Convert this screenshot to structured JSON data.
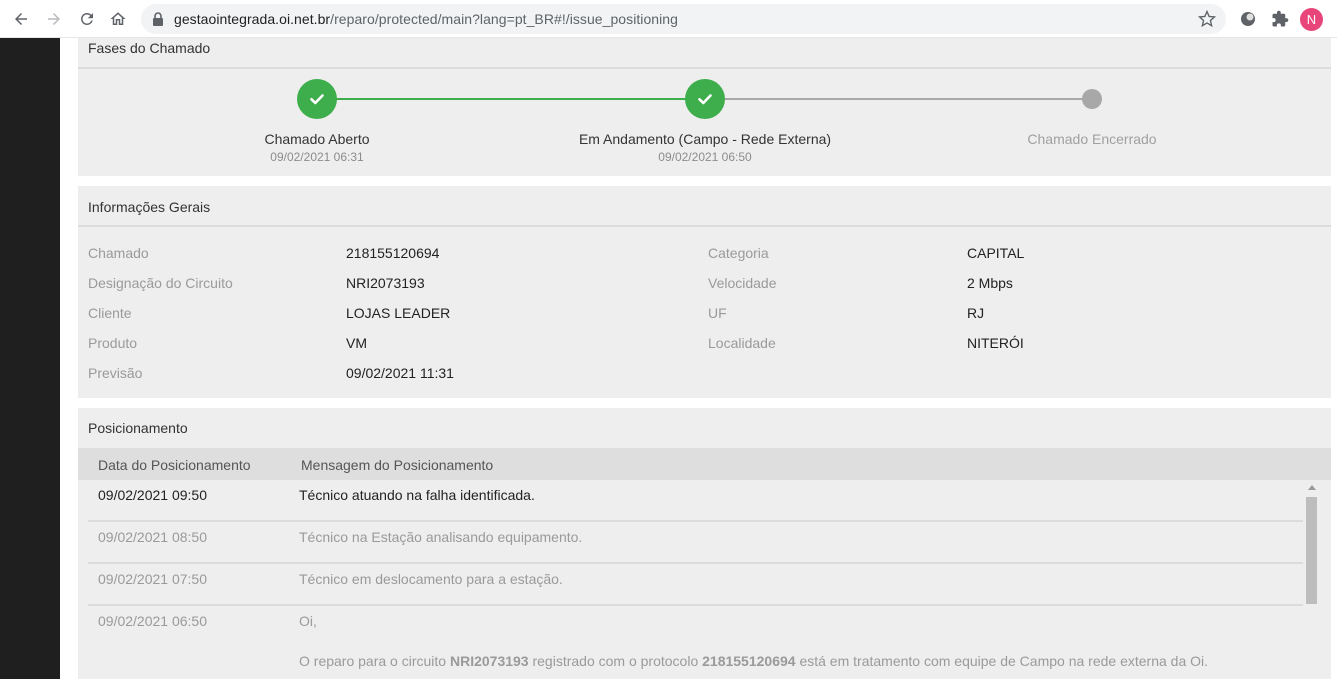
{
  "browser": {
    "url_host": "gestaointegrada.oi.net.br",
    "url_path": "/reparo/protected/main?lang=pt_BR#!/issue_positioning",
    "profile_initial": "N",
    "icons": [
      "back-arrow-icon",
      "forward-arrow-icon",
      "reload-icon",
      "home-icon",
      "lock-icon",
      "star-icon",
      "extension-circle-icon",
      "puzzle-icon"
    ]
  },
  "phases": {
    "title": "Fases do Chamado",
    "steps": [
      {
        "label": "Chamado Aberto",
        "date": "09/02/2021 06:31",
        "status": "done"
      },
      {
        "label": "Em Andamento (Campo - Rede Externa)",
        "date": "09/02/2021 06:50",
        "status": "done"
      },
      {
        "label": "Chamado Encerrado",
        "date": "",
        "status": "pending"
      }
    ]
  },
  "info": {
    "title": "Informações Gerais",
    "left": [
      {
        "label": "Chamado",
        "value": "218155120694"
      },
      {
        "label": "Designação do Circuito",
        "value": "NRI2073193"
      },
      {
        "label": "Cliente",
        "value": "LOJAS LEADER"
      },
      {
        "label": "Produto",
        "value": "VM"
      },
      {
        "label": "Previsão",
        "value": "09/02/2021 11:31"
      }
    ],
    "right": [
      {
        "label": "Categoria",
        "value": "CAPITAL"
      },
      {
        "label": "Velocidade",
        "value": "2 Mbps"
      },
      {
        "label": "UF",
        "value": "RJ"
      },
      {
        "label": "Localidade",
        "value": "NITERÓI"
      }
    ]
  },
  "positioning": {
    "title": "Posicionamento",
    "columns": [
      "Data do Posicionamento",
      "Mensagem do Posicionamento"
    ],
    "rows": [
      {
        "date": "09/02/2021 09:50",
        "message": "Técnico atuando na falha identificada."
      },
      {
        "date": "09/02/2021 08:50",
        "message": "Técnico na Estação analisando equipamento."
      },
      {
        "date": "09/02/2021 07:50",
        "message": "Técnico em deslocamento para a estação."
      },
      {
        "date": "09/02/2021 06:50",
        "message": "Oi,",
        "message_2_parts": [
          "O reparo para o circuito ",
          "NRI2073193",
          " registrado com o protocolo ",
          "218155120694",
          " está em tratamento com equipe de Campo na rede externa da Oi."
        ]
      }
    ]
  },
  "colors": {
    "success": "#3dae4b",
    "pending": "#a8a8a8",
    "avatar": "#e8457a"
  }
}
